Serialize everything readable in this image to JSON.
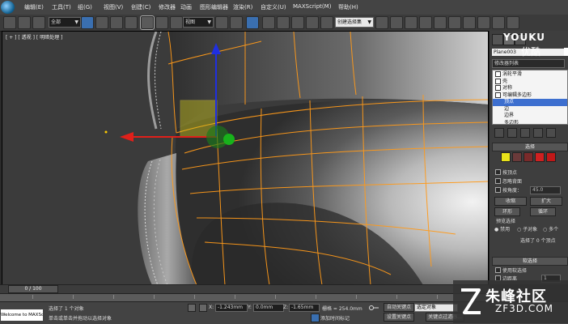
{
  "menu": [
    "编辑(E)",
    "工具(T)",
    "组(G)",
    "视图(V)",
    "创建(C)",
    "修改器",
    "动画",
    "图形编辑器",
    "渲染(R)",
    "自定义(U)",
    "MAXScript(M)",
    "帮助(H)"
  ],
  "toolbar": {
    "selection_filter": "全部",
    "ref_coord": "视图",
    "named_selection": "创建选择集"
  },
  "viewport": {
    "label": "[ + ] [ 透视 ] [ 明暗处理 ]",
    "gizmo_colors": {
      "x": "#e0201a",
      "y": "#1f2fe0",
      "z": "#18b21b"
    },
    "wire_color": "#ff9a1a"
  },
  "panel": {
    "object_name": "Plane003",
    "modifier_list": "修改器列表",
    "stack": [
      {
        "label": "涡轮平滑",
        "highlight": false
      },
      {
        "label": "壳",
        "highlight": false
      },
      {
        "label": "对称",
        "highlight": false
      },
      {
        "label": "可编辑多边形",
        "highlight": false
      },
      {
        "label": "顶点",
        "highlight": true
      },
      {
        "label": "边",
        "highlight": false
      },
      {
        "label": "边界",
        "highlight": false
      },
      {
        "label": "多边形",
        "highlight": false
      },
      {
        "label": "元素",
        "highlight": false
      }
    ],
    "selection_rollout": "选择",
    "by_vertex": "按顶点",
    "ignore_backfacing": "忽略背面",
    "by_angle": "按角度：",
    "angle_value": "45.0",
    "shrink": "收缩",
    "grow": "扩大",
    "ring": "环形",
    "loop": "循环",
    "preview_selection": "预览选择",
    "preview_off": "禁用",
    "preview_subobj": "子对象",
    "preview_multi": "多个",
    "selected_count": "选择了 0 个顶点",
    "soft_selection": "软选择",
    "use_soft": "使用软选择",
    "edge_distance": "边距离",
    "edge_distance_value": "1"
  },
  "timeline": {
    "frame": "0 / 100"
  },
  "status": {
    "maxscript": "Welcome to MAXScript.",
    "selected": "选择了 1 个对象",
    "prompt": "单击或单击并拖动以选择对象",
    "x_label": "X:",
    "x_value": "-1.243mm",
    "y_label": "Y:",
    "y_value": "0.0mm",
    "z_label": "Z:",
    "z_value": "-1.65mm",
    "grid": "栅格 = 254.0mm",
    "add_time_tag": "添加时间标记",
    "auto_key": "自动关键点",
    "selected_obj": "选定对象",
    "set_key": "设置关键点",
    "key_filters": "关键点过滤器..."
  },
  "watermarks": {
    "youku": "YOUKU",
    "youku_cn": "优酷",
    "zf_main": "朱峰社区",
    "zf_sub": "ZF3D.COM"
  }
}
